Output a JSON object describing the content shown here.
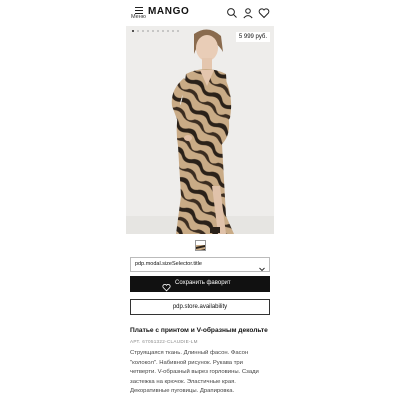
{
  "header": {
    "menu_label": "Меню",
    "logo": "MANGO",
    "icons": [
      "search-icon",
      "user-icon",
      "heart-icon"
    ]
  },
  "gallery": {
    "price": "5 999 руб.",
    "image_count": 10,
    "active_index": 0
  },
  "size_selector": {
    "label": "pdp.modal.sizeSelector.title",
    "icon": "chevron-down-icon"
  },
  "buttons": {
    "save_favorite": "Сохранить фаворит",
    "store_availability": "pdp.store.availability"
  },
  "product": {
    "title": "Платье с принтом и V-образным декольте",
    "ref": "АРТ. 67051322-CLAUDIE-LM",
    "description_lines": [
      "Струящаяся ткань. Длинный фасон. Фасон",
      "\"колокол\". Набивной рисунок. Рукава три",
      "четверти. V-образный вырез горловины. Сзади",
      "застежка на крючок. Эластичные края.",
      "Декоративные пуговицы. Драпировка."
    ]
  },
  "colors": {
    "background": "#ffffff",
    "primary_button": "#111111",
    "dress_tan": "#c9ab86",
    "dress_dark": "#2a2119"
  }
}
